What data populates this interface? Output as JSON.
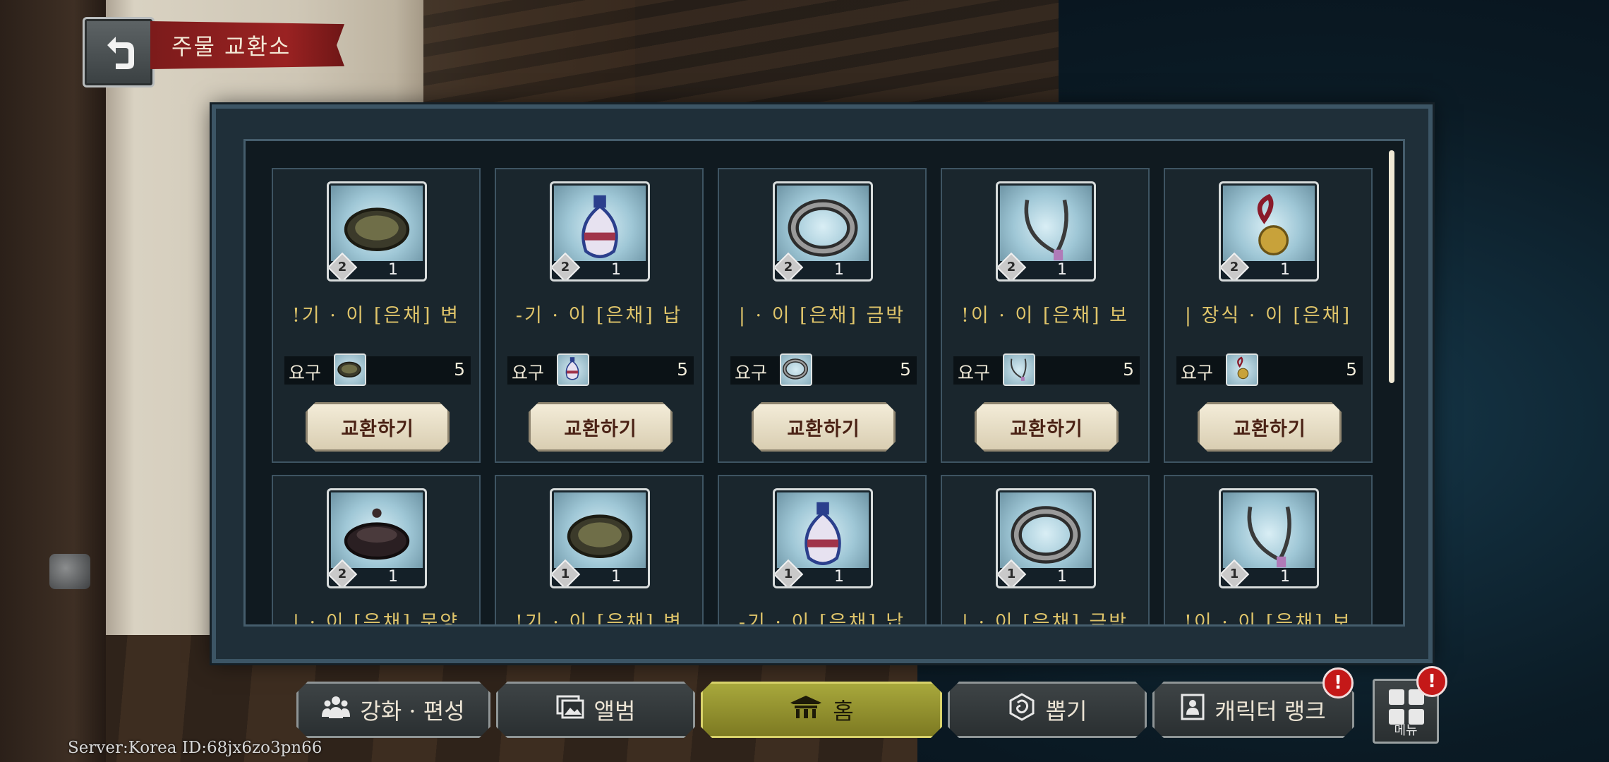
{
  "header": {
    "back_icon": "back-arrow-icon",
    "title": "주물 교환소"
  },
  "cards": [
    {
      "grade": "2",
      "count": "1",
      "name": "!기 · 이 [은채] 변",
      "req_label": "요구",
      "req_num": "5",
      "button": "교환하기",
      "icon": "plate-icon"
    },
    {
      "grade": "2",
      "count": "1",
      "name": "-기 · 이 [은채] 납",
      "req_label": "요구",
      "req_num": "5",
      "button": "교환하기",
      "icon": "bottle-icon"
    },
    {
      "grade": "2",
      "count": "1",
      "name": "| · 이 [은채] 금박",
      "req_label": "요구",
      "req_num": "5",
      "button": "교환하기",
      "icon": "bracelet-icon"
    },
    {
      "grade": "2",
      "count": "1",
      "name": "!이 · 이 [은채] 보",
      "req_label": "요구",
      "req_num": "5",
      "button": "교환하기",
      "icon": "necklace-icon"
    },
    {
      "grade": "2",
      "count": "1",
      "name": "| 장식 · 이 [은채]",
      "req_label": "요구",
      "req_num": "5",
      "button": "교환하기",
      "icon": "bell-charm-icon"
    },
    {
      "grade": "2",
      "count": "1",
      "name": "| · 이 [은채] 문양",
      "icon": "incense-burner-icon"
    },
    {
      "grade": "1",
      "count": "1",
      "name": "!기 · 이 [은채] 변",
      "icon": "plate-icon"
    },
    {
      "grade": "1",
      "count": "1",
      "name": "-기 · 이 [은채] 납",
      "icon": "bottle-icon"
    },
    {
      "grade": "1",
      "count": "1",
      "name": "| · 이 [은채] 금박",
      "icon": "bracelet-icon"
    },
    {
      "grade": "1",
      "count": "1",
      "name": "!이 · 이 [은채] 보",
      "icon": "necklace-icon"
    }
  ],
  "nav": {
    "enhance": "강화 · 편성",
    "album": "앨범",
    "home": "홈",
    "draw": "뽑기",
    "rank": "캐릭터 랭크",
    "menu": "메뉴",
    "alert_mark": "!"
  },
  "footer": {
    "server_text": "Server:Korea ID:68jx6zo3pn66"
  }
}
